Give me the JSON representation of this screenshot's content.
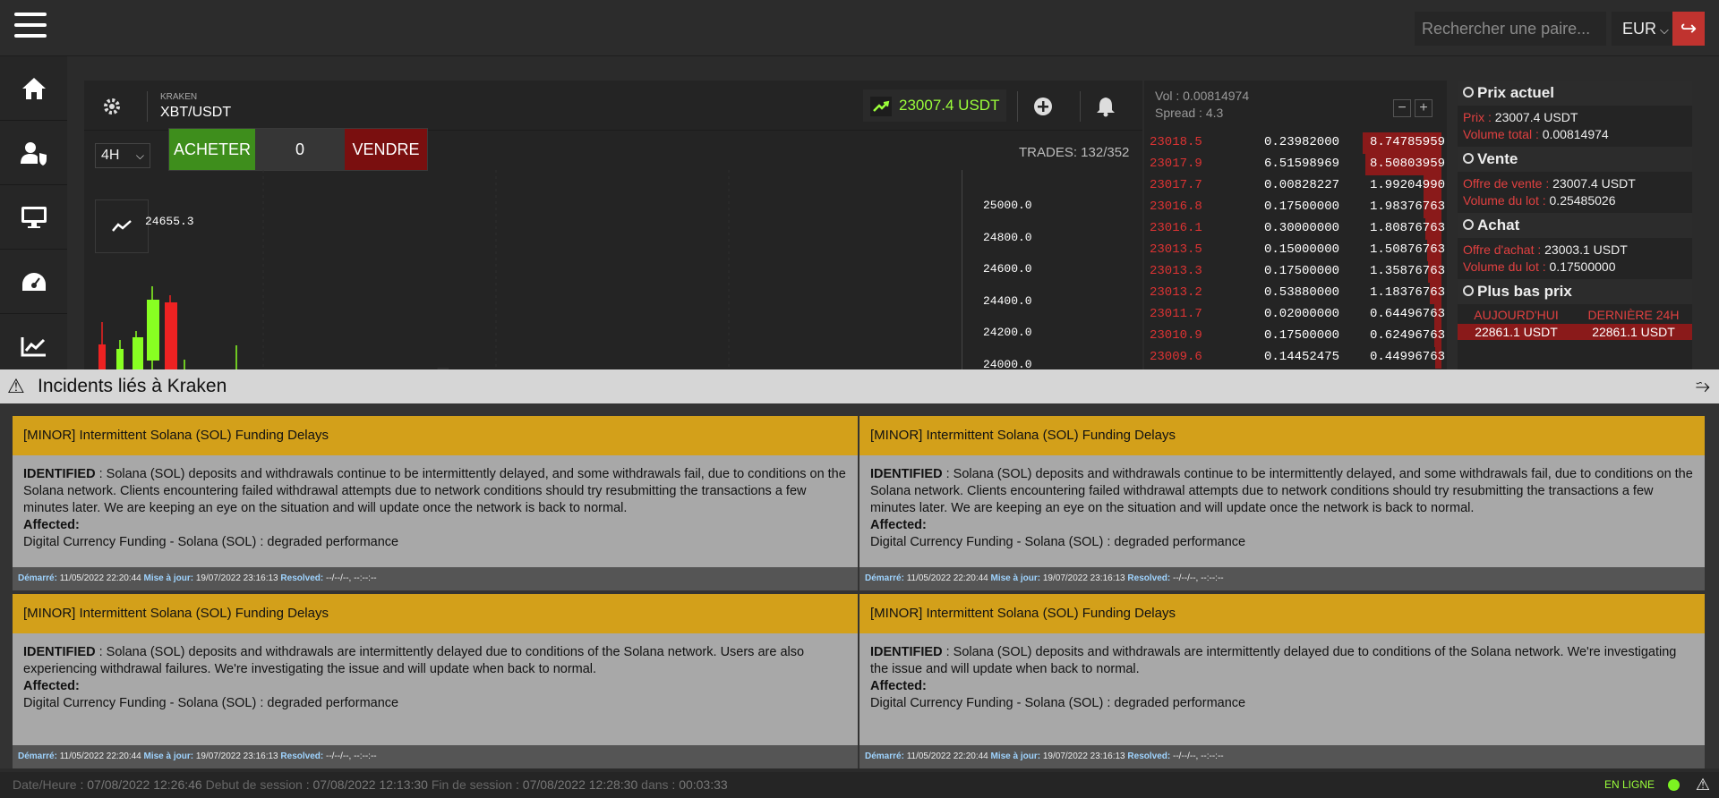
{
  "topbar": {
    "search_placeholder": "Rechercher une paire...",
    "currency": "EUR",
    "icons": {
      "menu": "hamburger-icon",
      "logout": "logout-icon"
    }
  },
  "sidebar": {
    "items": [
      {
        "name": "home",
        "icon": "home-icon"
      },
      {
        "name": "account",
        "icon": "user-shield-icon"
      },
      {
        "name": "desktop",
        "icon": "monitor-icon"
      },
      {
        "name": "dashboard",
        "icon": "gauge-icon"
      },
      {
        "name": "charts",
        "icon": "line-chart-icon"
      }
    ]
  },
  "chart": {
    "exchange": "KRAKEN",
    "pair": "XBT/USDT",
    "price": "23007.4 USDT",
    "timeframe": "4H",
    "buy_label": "ACHETER",
    "quantity": "0",
    "sell_label": "VENDRE",
    "trades": "TRADES: 132/352",
    "max_label": "24655.3",
    "watermark": "XBT/USDT",
    "y_ticks": [
      "25000.0",
      "24800.0",
      "24600.0",
      "24400.0",
      "24200.0",
      "24000.0"
    ]
  },
  "orderbook": {
    "vol_label": "Vol :",
    "vol_value": "0.00814974",
    "spread_label": "Spread :",
    "spread_value": "4.3",
    "rows": [
      {
        "price": "23018.5",
        "qty": "0.23982000",
        "total": "8.74785959",
        "depth": 0.27
      },
      {
        "price": "23017.9",
        "qty": "6.51598969",
        "total": "8.50803959",
        "depth": 0.26
      },
      {
        "price": "23017.7",
        "qty": "0.00828227",
        "total": "1.99204990",
        "depth": 0.06
      },
      {
        "price": "23016.8",
        "qty": "0.17500000",
        "total": "1.98376763",
        "depth": 0.06
      },
      {
        "price": "23016.1",
        "qty": "0.30000000",
        "total": "1.80876763",
        "depth": 0.055
      },
      {
        "price": "23013.5",
        "qty": "0.15000000",
        "total": "1.50876763",
        "depth": 0.05
      },
      {
        "price": "23013.3",
        "qty": "0.17500000",
        "total": "1.35876763",
        "depth": 0.045
      },
      {
        "price": "23013.2",
        "qty": "0.53880000",
        "total": "1.18376763",
        "depth": 0.04
      },
      {
        "price": "23011.7",
        "qty": "0.02000000",
        "total": "0.64496763",
        "depth": 0.025
      },
      {
        "price": "23010.9",
        "qty": "0.17500000",
        "total": "0.62496763",
        "depth": 0.025
      },
      {
        "price": "23009.6",
        "qty": "0.14452475",
        "total": "0.44996763",
        "depth": 0.02
      }
    ]
  },
  "stats": {
    "current": {
      "title": "Prix actuel",
      "price_label": "Prix :",
      "price": "23007.4 USDT",
      "volume_label": "Volume total :",
      "volume": "0.00814974"
    },
    "sell": {
      "title": "Vente",
      "offer_label": "Offre de vente :",
      "offer": "23007.4 USDT",
      "lot_label": "Volume du lot :",
      "lot": "0.25485026"
    },
    "buy": {
      "title": "Achat",
      "offer_label": "Offre d'achat :",
      "offer": "23003.1 USDT",
      "lot_label": "Volume du lot :",
      "lot": "0.17500000"
    },
    "low": {
      "title": "Plus bas prix",
      "today_label": "AUJOURD'HUI",
      "day_label": "DERNIÈRE 24H",
      "today": "22861.1 USDT",
      "day": "22861.1 USDT"
    }
  },
  "incidents": {
    "title": "Incidents liés à Kraken",
    "cards": [
      {
        "title": "[MINOR] Intermittent Solana (SOL) Funding Delays",
        "status": "IDENTIFIED",
        "text": " : Solana (SOL) deposits and withdrawals continue to be intermittently delayed, and some withdrawals fail, due to conditions on the Solana network. Clients encountering failed withdrawal attempts due to network conditions should try resubmitting the transactions a few minutes later. We are keeping an eye on the situation and will update once the network is back to normal.",
        "affected_label": "Affected:",
        "affected": "Digital Currency Funding - Solana (SOL) : degraded performance",
        "started_label": "Démarré:",
        "started": "11/05/2022 22:20:44",
        "updated_label": "Mise à jour:",
        "updated": "19/07/2022 23:16:13",
        "resolved_label": "Resolved:",
        "resolved": "--/--/--, --:--:--"
      },
      {
        "title": "[MINOR] Intermittent Solana (SOL) Funding Delays",
        "status": "IDENTIFIED",
        "text": " : Solana (SOL) deposits and withdrawals continue to be intermittently delayed, and some withdrawals fail, due to conditions on the Solana network. Clients encountering failed withdrawal attempts due to network conditions should try resubmitting the transactions a few minutes later. We are keeping an eye on the situation and will update once the network is back to normal.",
        "affected_label": "Affected:",
        "affected": "Digital Currency Funding - Solana (SOL) : degraded performance",
        "started_label": "Démarré:",
        "started": "11/05/2022 22:20:44",
        "updated_label": "Mise à jour:",
        "updated": "19/07/2022 23:16:13",
        "resolved_label": "Resolved:",
        "resolved": "--/--/--, --:--:--"
      },
      {
        "title": "[MINOR] Intermittent Solana (SOL) Funding Delays",
        "status": "IDENTIFIED",
        "text": " : Solana (SOL) deposits and withdrawals are intermittently delayed due to conditions of the Solana network. Users are also experiencing withdrawal failures. We're investigating the issue and will update when back to normal.",
        "affected_label": "Affected:",
        "affected": "Digital Currency Funding - Solana (SOL) : degraded performance",
        "started_label": "Démarré:",
        "started": "11/05/2022 22:20:44",
        "updated_label": "Mise à jour:",
        "updated": "19/07/2022 23:16:13",
        "resolved_label": "Resolved:",
        "resolved": "--/--/--, --:--:--"
      },
      {
        "title": "[MINOR] Intermittent Solana (SOL) Funding Delays",
        "status": "IDENTIFIED",
        "text": " : Solana (SOL) deposits and withdrawals are intermittently delayed due to conditions of the Solana network. We're investigating the issue and will update when back to normal.",
        "affected_label": "Affected:",
        "affected": "Digital Currency Funding - Solana (SOL) : degraded performance",
        "started_label": "Démarré:",
        "started": "11/05/2022 22:20:44",
        "updated_label": "Mise à jour:",
        "updated": "19/07/2022 23:16:13",
        "resolved_label": "Resolved:",
        "resolved": "--/--/--, --:--:--"
      }
    ]
  },
  "footer": {
    "date_label": "Date/Heure",
    "date": "07/08/2022 12:26:46",
    "start_label": "Debut de session",
    "start": "07/08/2022 12:13:30",
    "end_label": "Fin de session",
    "end": "07/08/2022 12:28:30",
    "in_label": "dans",
    "in": "00:03:33",
    "status": "EN LIGNE"
  },
  "colors": {
    "accent_green": "#9bff3a",
    "buy": "#3e8e1c",
    "sell": "#7a0f0f",
    "incident": "#d3a01a"
  }
}
